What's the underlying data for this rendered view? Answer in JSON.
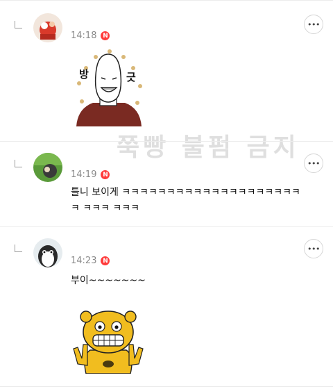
{
  "watermark": "쭉빵 불펌 금지",
  "comments": [
    {
      "time": "14:18",
      "badge": "N",
      "text": "",
      "sticker": "bald-man-sticker",
      "sticker_text": [
        "방",
        "긋"
      ]
    },
    {
      "time": "14:19",
      "badge": "N",
      "text_line1": "틀니 보이게 ㅋㅋㅋㅋㅋㅋㅋㅋㅋㅋㅋㅋㅋㅋㅋㅋㅋㅋㅋㅋ",
      "text_line2": "ㅋ ㅋㅋㅋ ㅋㅋㅋ"
    },
    {
      "time": "14:23",
      "badge": "N",
      "text": "부이~~~~~~~",
      "sticker": "yellow-character-sticker"
    }
  ],
  "more_label": "•••",
  "icons": {
    "reply": "reply-arrow-icon",
    "more": "more-options-icon",
    "new": "new-badge"
  }
}
